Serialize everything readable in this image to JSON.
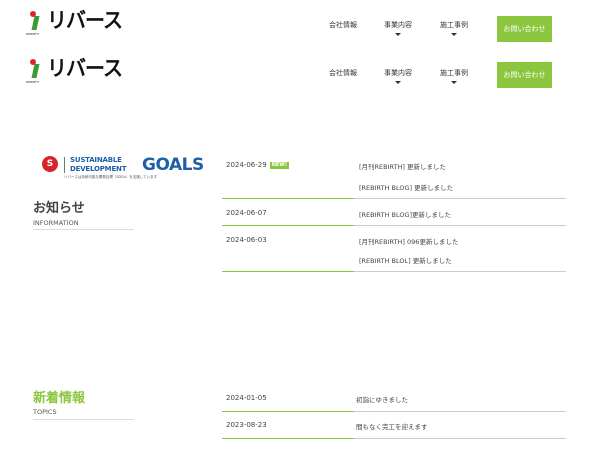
{
  "header": {
    "logo_text": "リバース",
    "logo_sub": "REBIRTH",
    "nav": [
      {
        "label": "会社情報"
      },
      {
        "label": "事業内容"
      },
      {
        "label": "施工事例"
      }
    ],
    "contact_label": "お問い合わせ"
  },
  "sdgs": {
    "mark": "S",
    "line1": "SUSTAINABLE",
    "line2": "DEVELOPMENT",
    "goals": "GOALS",
    "caption": "リバースは持続可能な開発目標（SDGs）を支援しています"
  },
  "information": {
    "title": "お知らせ",
    "subtitle": "INFORMATION",
    "items": [
      {
        "date": "2024-06-29",
        "badge": "NEW!",
        "lines": [
          "[月刊REBIRTH] 更新しました",
          "[REBIRTH BLOG] 更新しました"
        ]
      },
      {
        "date": "2024-06-07",
        "lines": [
          "[REBIRTH BLOG]更新しました"
        ]
      },
      {
        "date": "2024-06-03",
        "lines": [
          "[月刊REBIRTH] 096更新しました",
          "[REBIRTH BLOL] 更新しました"
        ]
      }
    ]
  },
  "topics": {
    "title": "新着情報",
    "subtitle": "TOPICS",
    "items": [
      {
        "date": "2024-01-05",
        "text": "初詣にゆきました"
      },
      {
        "date": "2023-08-23",
        "text": "間もなく完工を迎えます"
      }
    ]
  },
  "colors": {
    "accent_green": "#8cc63f",
    "logo_green": "#3a9a35",
    "logo_red": "#e0242a",
    "sdgs_blue": "#1e5fa8"
  }
}
